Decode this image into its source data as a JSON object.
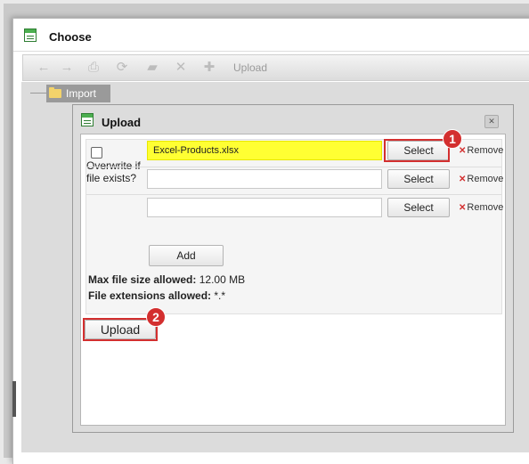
{
  "window": {
    "title": "Choose"
  },
  "toolbar": {
    "buttons": [
      {
        "name": "back-icon",
        "glyph": "←"
      },
      {
        "name": "forward-icon",
        "glyph": "→"
      },
      {
        "name": "print-icon",
        "glyph": "⎙"
      },
      {
        "name": "refresh-icon",
        "glyph": "⟳"
      },
      {
        "name": "new-folder-icon",
        "glyph": "▰"
      },
      {
        "name": "delete-icon",
        "glyph": "✕"
      },
      {
        "name": "add-icon",
        "glyph": "✚"
      }
    ],
    "upload_label": "Upload"
  },
  "tree": {
    "folder_label": "Import"
  },
  "dialog": {
    "title": "Upload",
    "close_glyph": "✕",
    "overwrite_label": "Overwrite if file exists?",
    "file_rows": [
      {
        "value": "Excel-Products.xlsx",
        "select_label": "Select",
        "remove_label": "Remove"
      },
      {
        "value": "",
        "select_label": "Select",
        "remove_label": "Remove"
      },
      {
        "value": "",
        "select_label": "Select",
        "remove_label": "Remove"
      }
    ],
    "add_label": "Add",
    "max_size_label": "Max file size allowed:",
    "max_size_value": "12.00 MB",
    "extensions_label": "File extensions allowed:",
    "extensions_value": "*.*",
    "upload_label": "Upload"
  },
  "annotations": {
    "step1": "1",
    "step2": "2"
  },
  "colors": {
    "highlight_red": "#d32f2f",
    "file_yellow": "#ffff33",
    "accent_green": "#4caf50"
  }
}
